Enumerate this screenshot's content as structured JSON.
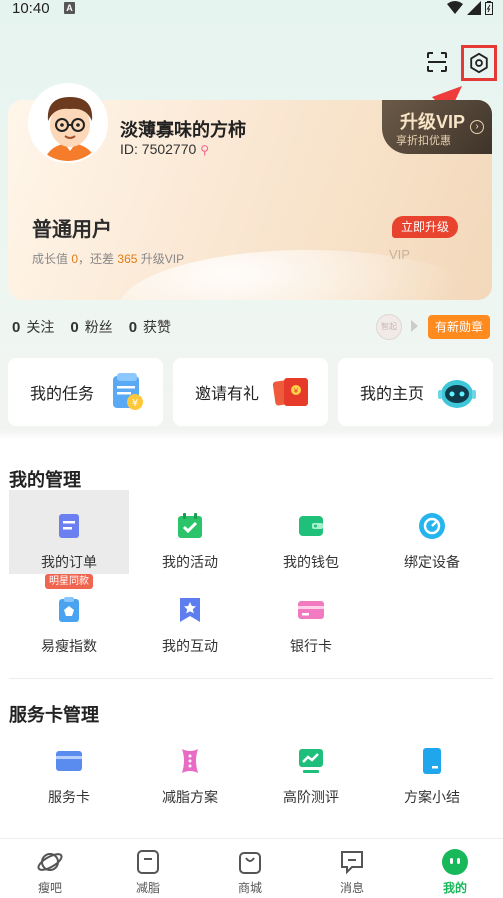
{
  "status_bar": {
    "time": "10:40",
    "sim_label": "A"
  },
  "profile": {
    "username": "淡薄寡味的方柿",
    "user_id": "ID: 7502770",
    "member_level": "普通用户",
    "growth_prefix": "成长值",
    "growth_value": "0",
    "growth_mid": "，还差",
    "growth_needed": "365",
    "growth_suffix": "升级VIP",
    "upgrade_button": "立即升级",
    "vip_watermark": "VIP",
    "vip_tag_title": "升级VIP",
    "vip_tag_subtitle": "享折扣优惠"
  },
  "stats": [
    {
      "count": "0",
      "label": "关注"
    },
    {
      "count": "0",
      "label": "粉丝"
    },
    {
      "count": "0",
      "label": "获赞"
    }
  ],
  "medal": {
    "icon_text": "智起",
    "badge": "有新勋章"
  },
  "quick_cards": [
    {
      "label": "我的任务",
      "icon": "task-clipboard-icon"
    },
    {
      "label": "邀请有礼",
      "icon": "red-envelope-icon"
    },
    {
      "label": "我的主页",
      "icon": "robot-icon"
    }
  ],
  "management": {
    "title": "我的管理",
    "items": [
      {
        "label": "我的订单",
        "icon": "order-icon"
      },
      {
        "label": "我的活动",
        "icon": "calendar-check-icon"
      },
      {
        "label": "我的钱包",
        "icon": "wallet-icon"
      },
      {
        "label": "绑定设备",
        "icon": "device-icon"
      },
      {
        "label": "易瘦指数",
        "icon": "index-clipboard-icon"
      },
      {
        "label": "我的互动",
        "icon": "star-bookmark-icon"
      },
      {
        "label": "银行卡",
        "icon": "bank-card-icon"
      }
    ],
    "star_badge": "明星同款"
  },
  "service": {
    "title": "服务卡管理",
    "items": [
      {
        "label": "服务卡",
        "icon": "card-icon"
      },
      {
        "label": "减脂方案",
        "icon": "corset-icon"
      },
      {
        "label": "高阶测评",
        "icon": "monitor-chart-icon"
      },
      {
        "label": "方案小结",
        "icon": "notebook-icon"
      }
    ]
  },
  "tabs": [
    {
      "label": "瘦吧",
      "icon": "planet-icon"
    },
    {
      "label": "减脂",
      "icon": "square-icon"
    },
    {
      "label": "商城",
      "icon": "shopping-bag-icon"
    },
    {
      "label": "消息",
      "icon": "message-icon"
    },
    {
      "label": "我的",
      "icon": "smiley-face-icon",
      "active": true
    }
  ],
  "colors": {
    "accent_green": "#16b85a",
    "highlight_red": "#e53935",
    "badge_orange": "#ff8a1e"
  }
}
